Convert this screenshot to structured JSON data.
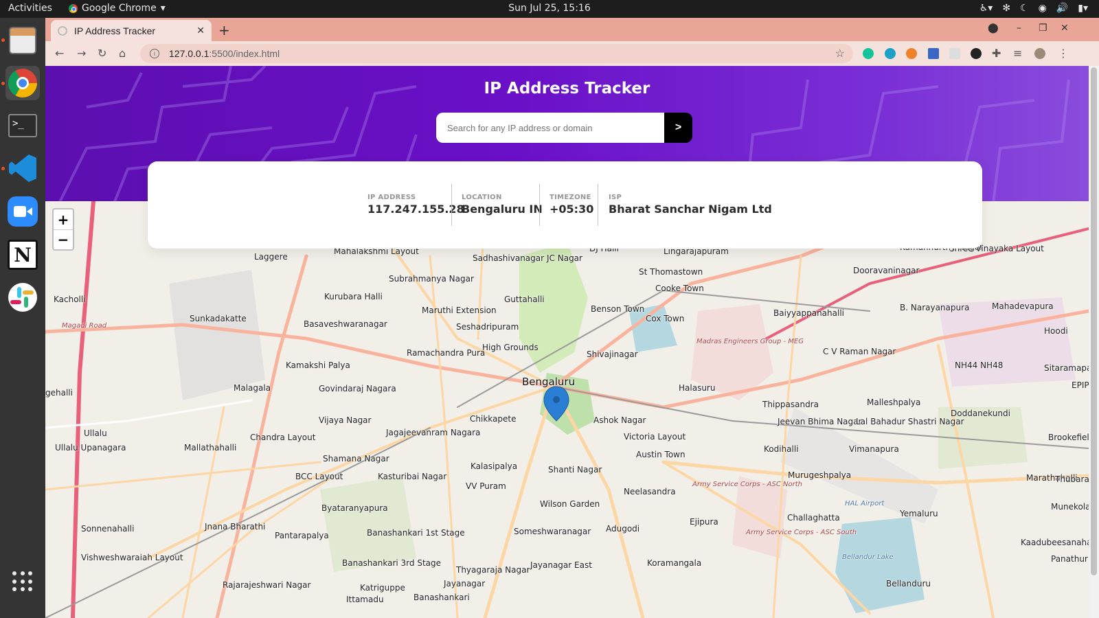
{
  "os_bar": {
    "activities": "Activities",
    "app_name": "Google Chrome",
    "clock": "Sun Jul 25, 15:16"
  },
  "browser": {
    "tab_title": "IP Address Tracker",
    "url_host": "127.0.0.1",
    "url_path": ":5500/index.html"
  },
  "app": {
    "title": "IP Address Tracker",
    "search_placeholder": "Search for any IP address or domain",
    "submit_symbol": ">"
  },
  "info": {
    "ip_label": "IP ADDRESS",
    "ip_value": "117.247.155.28",
    "location_label": "LOCATION",
    "location_value": "Bengaluru IN",
    "timezone_label": "TIMEZONE",
    "timezone_value": "+05:30",
    "isp_label": "ISP",
    "isp_value": "Bharat Sanchar Nigam Ltd"
  },
  "map": {
    "zoom_in": "+",
    "zoom_out": "−",
    "labels": [
      "Laggere",
      "Mahalakshmi Layout",
      "Sadhashivanagar",
      "JC Nagar",
      "DJ Halli",
      "Lingarajapuram",
      "Kamanhurthy Nagar",
      "Shree Vinayaka Layout",
      "Subrahmanya Nagar",
      "Kurubara Halli",
      "Guttahalli",
      "St Thomastown",
      "Dooravaninagar",
      "Kacholli",
      "Sunkadakatte",
      "Maruthi Extension",
      "Benson Town",
      "Cooke Town",
      "Cox Town",
      "Baiyyappanahalli",
      "B. Narayanapura",
      "Mahadevapura",
      "Basaveshwaranagar",
      "Seshadripuram",
      "High Grounds",
      "Shivajinagar",
      "Ramachandra Pura",
      "C V Raman Nagar",
      "Hoodi",
      "Kamakshi Palya",
      "Malagala",
      "Govindaraj Nagara",
      "Bengaluru",
      "Halasuru",
      "Sitaramapalya",
      "Chikkapete",
      "Thippasandra",
      "Malleshpalya",
      "Doddanekundi",
      "EPIP",
      "Vijaya Nagar",
      "Ashok Nagar",
      "Jeevan Bhima Nagar",
      "Lal Bahadur Shastri Nagar",
      "Brookefields",
      "Ullalu",
      "Chandra Layout",
      "Jagajeevanram Nagara",
      "Victoria Layout",
      "Ullalu Upanagara",
      "Mallathahalli",
      "Shamana Nagar",
      "Austin Town",
      "Kodihalli",
      "Vimanapura",
      "Kalasipalya",
      "Shanti Nagar",
      "Murugeshpalya",
      "Marathahalli",
      "Thubarahalli",
      "BCC Layout",
      "Kasturibai Nagar",
      "VV Puram",
      "Neelasandra",
      "Byataranyapura",
      "Wilson Garden",
      "Ejipura",
      "Challaghatta",
      "Yemaluru",
      "Munekolala",
      "Sonnenahalli",
      "Jnana Bharathi",
      "Pantarapalya",
      "Banashankari 1st Stage",
      "Someshwaranagar",
      "Adugodi",
      "Kaadubeesanahalli",
      "Vishweshwaraiah Layout",
      "Banashankari 3rd Stage",
      "Thyagaraja Nagar",
      "Jayanagar East",
      "Koramangala",
      "Panathur",
      "Rajarajeshwari Nagar",
      "Katriguppe",
      "Jayanagar",
      "Bellanduru",
      "Banashankari",
      "Ittamadu",
      "gehalli",
      "Magadi Road",
      "HAL Airport",
      "Bellandur Lake",
      "Madras Engineers Group - MEG",
      "Army Service Corps - ASC North",
      "Army Service Corps - ASC South",
      "NH44 NH48"
    ]
  },
  "colors": {
    "hero_start": "#5c0fb0",
    "hero_end": "#8a4cdc",
    "marker": "#2a7fd4",
    "dark": "#2b2b2b",
    "label_gray": "#969696"
  }
}
